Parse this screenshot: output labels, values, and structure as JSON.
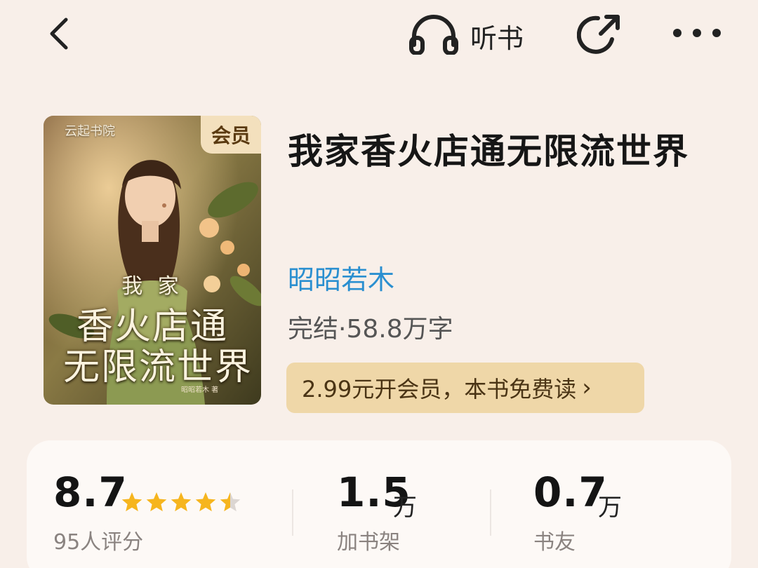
{
  "header": {
    "listen_label": "听书",
    "icons": [
      "back-icon",
      "headphones-icon",
      "share-icon",
      "more-icon"
    ]
  },
  "cover": {
    "publisher": "云起书院",
    "badge": "会员",
    "title_small": "我 家",
    "title_line1": "香火店通",
    "title_line2": "无限流世界",
    "author_small": "昭昭若木 著"
  },
  "book": {
    "title": "我家香火店通无限流世界",
    "author": "昭昭若木",
    "status": "完结·58.8万字",
    "vip_offer": "2.99元开会员，本书免费读",
    "vip_chevron": "›"
  },
  "stats": {
    "rating": {
      "value": "8.7",
      "label": "95人评分",
      "stars": 4.5
    },
    "shelf": {
      "value": "1.5",
      "unit": "万",
      "label": "加书架"
    },
    "friends": {
      "value": "0.7",
      "unit": "万",
      "label": "书友"
    }
  },
  "colors": {
    "background": "#f8efe9",
    "author_link": "#2a8fd0",
    "vip_bg": "#efd7a8",
    "star": "#f6b51e"
  }
}
